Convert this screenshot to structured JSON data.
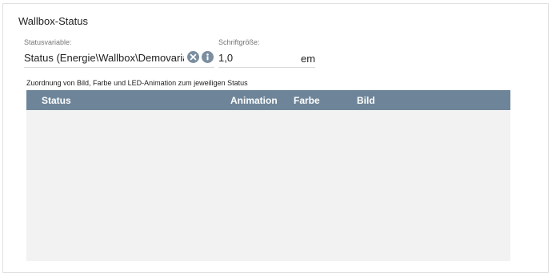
{
  "panel": {
    "title": "Wallbox-Status"
  },
  "status_variable": {
    "label": "Statusvariable:",
    "value": "Status (Energie\\Wallbox\\Demovariable)",
    "clear_icon": "clear-circle-icon",
    "info_icon": "info-circle-icon"
  },
  "font_size": {
    "label": "Schriftgröße:",
    "value": "1,0",
    "unit": "em"
  },
  "assignment": {
    "description": "Zuordnung von Bild, Farbe und LED-Animation zum jeweiligen Status",
    "columns": [
      "Status",
      "Animation",
      "Farbe",
      "Bild"
    ],
    "rows": []
  },
  "colors": {
    "table_header": "#6e8599",
    "table_body": "#f2f2f2",
    "icon": "#7b8ea0"
  }
}
